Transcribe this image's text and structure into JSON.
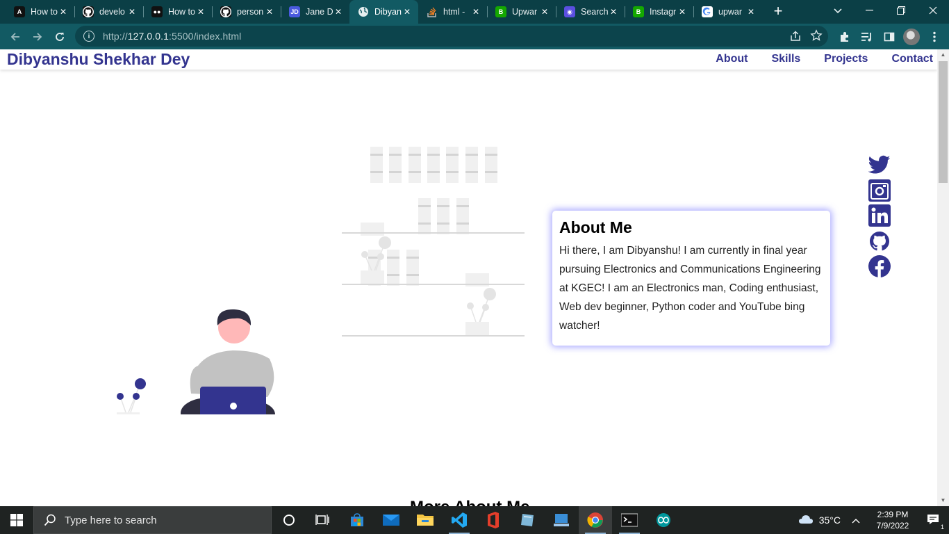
{
  "browser": {
    "tabs": [
      {
        "label": "How to",
        "icon": "angular-icon",
        "fav_bg": "#111",
        "fav_text": "A"
      },
      {
        "label": "develo",
        "icon": "github-icon",
        "fav_bg": "#111",
        "fav_text": ""
      },
      {
        "label": "How to",
        "icon": "medium-icon",
        "fav_bg": "#111",
        "fav_text": "●●"
      },
      {
        "label": "person",
        "icon": "github-icon",
        "fav_bg": "#111",
        "fav_text": ""
      },
      {
        "label": "Jane D",
        "icon": "jd-icon",
        "fav_bg": "#4a5adf",
        "fav_text": "JD"
      },
      {
        "label": "Dibyan",
        "icon": "globe-icon",
        "fav_bg": "transparent",
        "fav_text": "",
        "active": true
      },
      {
        "label": "html -",
        "icon": "stackoverflow-icon",
        "fav_bg": "transparent",
        "fav_text": ""
      },
      {
        "label": "Upwar",
        "icon": "upwork-icon",
        "fav_bg": "#14a800",
        "fav_text": "B"
      },
      {
        "label": "Search",
        "icon": "search-engine-icon",
        "fav_bg": "#5b4fe0",
        "fav_text": "◉"
      },
      {
        "label": "Instagr",
        "icon": "upwork-icon",
        "fav_bg": "#14a800",
        "fav_text": "B"
      },
      {
        "label": "upwar",
        "icon": "google-icon",
        "fav_bg": "#fff",
        "fav_text": "G"
      }
    ],
    "url_prefix": "http://",
    "url_host": "127.0.0.1",
    "url_rest": ":5500/index.html"
  },
  "page": {
    "brand": "Dibyanshu Shekhar Dey",
    "nav": [
      "About",
      "Skills",
      "Projects",
      "Contact"
    ],
    "about_title": "About Me",
    "about_text": "Hi there, I am Dibyanshu! I am currently in final year pursuing Electronics and Communications Engineering at KGEC! I am an Electronics man, Coding enthusiast, Web dev beginner, Python coder and YouTube bing watcher!",
    "socials": [
      "twitter-icon",
      "instagram-icon",
      "linkedin-icon",
      "github-icon",
      "facebook-icon"
    ],
    "more_heading": "More About Me",
    "accent_color": "#33348f",
    "card_glow_color": "#5f5fff"
  },
  "taskbar": {
    "search_placeholder": "Type here to search",
    "weather": "35°C",
    "time": "2:39 PM",
    "date": "7/9/2022",
    "notification_count": "1"
  }
}
